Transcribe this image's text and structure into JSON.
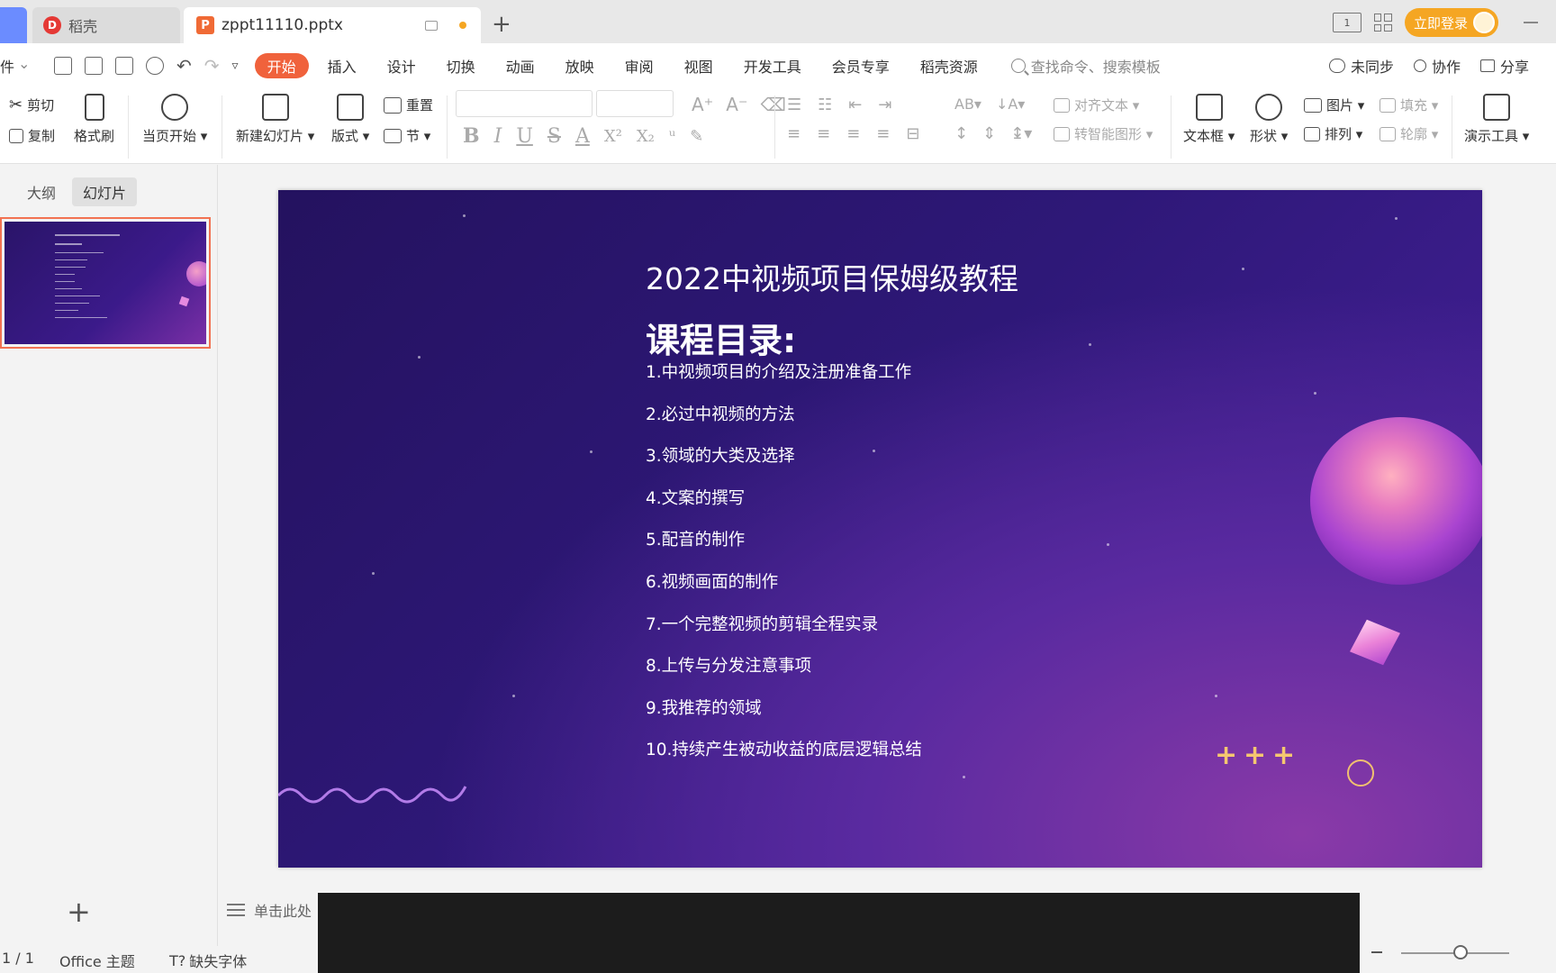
{
  "titlebar": {
    "app_tab": "稻壳",
    "file_tab": "zppt11110.pptx",
    "new_tab": "+",
    "login": "立即登录"
  },
  "menu": {
    "file_partial": "件",
    "tabs": [
      "开始",
      "插入",
      "设计",
      "切换",
      "动画",
      "放映",
      "审阅",
      "视图",
      "开发工具",
      "会员专享",
      "稻壳资源"
    ],
    "search_placeholder": "查找命令、搜索模板",
    "sync": "未同步",
    "collab": "协作",
    "share": "分享"
  },
  "ribbon": {
    "cut": "剪切",
    "copy": "复制",
    "format_painter": "格式刷",
    "play_from_current": "当页开始",
    "new_slide": "新建幻灯片",
    "layout": "版式",
    "reset": "重置",
    "section": "节",
    "align_text": "对齐文本",
    "smart_art": "转智能图形",
    "text_box": "文本框",
    "shape": "形状",
    "picture": "图片",
    "arrange": "排列",
    "fill": "填充",
    "outline": "轮廓",
    "presenter_tools": "演示工具"
  },
  "left_panel": {
    "tab_outline": "大纲",
    "tab_slides": "幻灯片"
  },
  "slide": {
    "title": "2022中视频项目保姆级教程",
    "subtitle": "课程目录:",
    "items": [
      "1.中视频项目的介绍及注册准备工作",
      "2.必过中视频的方法",
      "3.领域的大类及选择",
      "4.文案的撰写",
      "5.配音的制作",
      "6.视频画面的制作",
      "7.一个完整视频的剪辑全程实录",
      "8.上传与分发注意事项",
      "9.我推荐的领域",
      "10.持续产生被动收益的底层逻辑总结"
    ],
    "plus_marks": [
      "+",
      "+",
      "+"
    ]
  },
  "notes": {
    "placeholder": "单击此处"
  },
  "statusbar": {
    "page": "1 / 1",
    "theme": "Office 主题",
    "missing_font": "缺失字体"
  },
  "colors": {
    "accent": "#f0623c",
    "login": "#f5a623",
    "slide_bg": "#2e1878"
  }
}
